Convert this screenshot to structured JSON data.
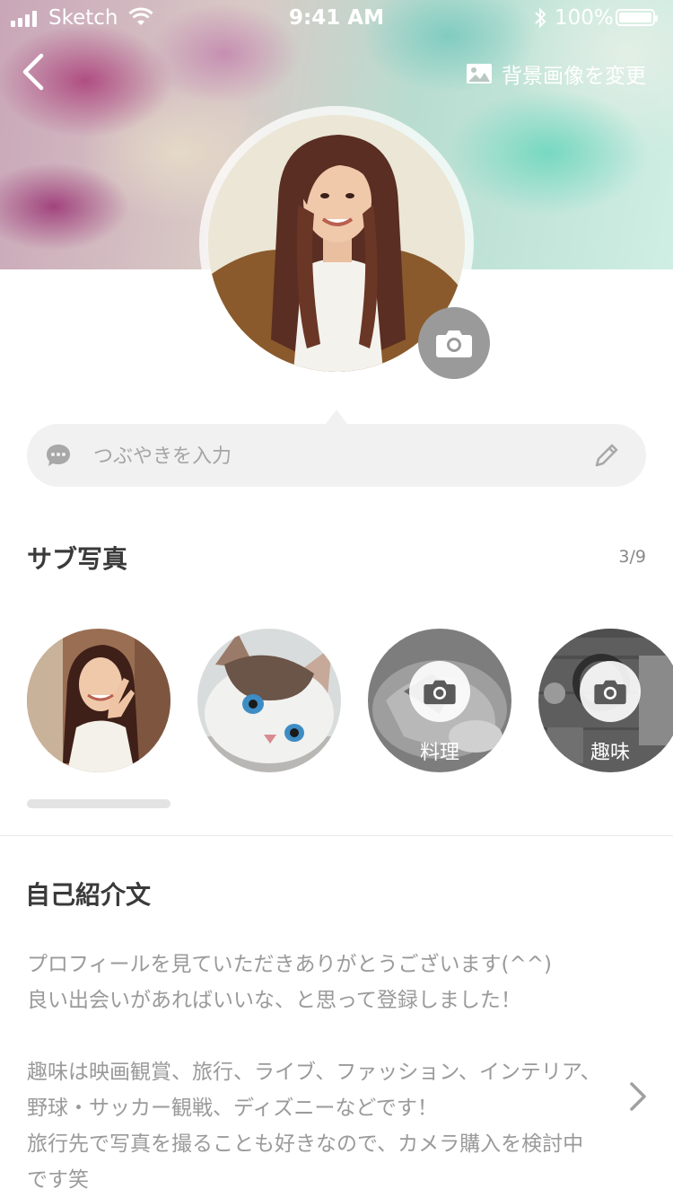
{
  "status_bar": {
    "carrier": "Sketch",
    "time": "9:41 AM",
    "battery": "100%"
  },
  "header": {
    "change_background_label": "背景画像を変更",
    "icons": [
      "back-chevron-icon",
      "image-icon",
      "camera-icon"
    ]
  },
  "tweet": {
    "placeholder": "つぶやきを入力",
    "value": ""
  },
  "sub_photos": {
    "title": "サブ写真",
    "count": "3/9",
    "items": [
      {
        "type": "photo",
        "subject": "woman"
      },
      {
        "type": "photo",
        "subject": "cat"
      },
      {
        "type": "empty",
        "label": "料理"
      },
      {
        "type": "empty",
        "label": "趣味"
      }
    ]
  },
  "intro": {
    "title": "自己紹介文",
    "lines": [
      "プロフィールを見ていただきありがとうございます(^^)",
      "良い出会いがあればいいな、と思って登録しました！",
      "",
      "趣味は映画観賞、旅行、ライブ、ファッション、インテリア、",
      "野球・サッカー観戦、ディズニーなどです！",
      "旅行先で写真を撮ることも好きなので、カメラ購入を検討中",
      "です笑"
    ]
  },
  "colors": {
    "text_dark": "#3a3a3a",
    "text_muted": "#9a9a9a",
    "input_bg": "#f1f1f1",
    "camera_button": "#9a9a9a"
  }
}
